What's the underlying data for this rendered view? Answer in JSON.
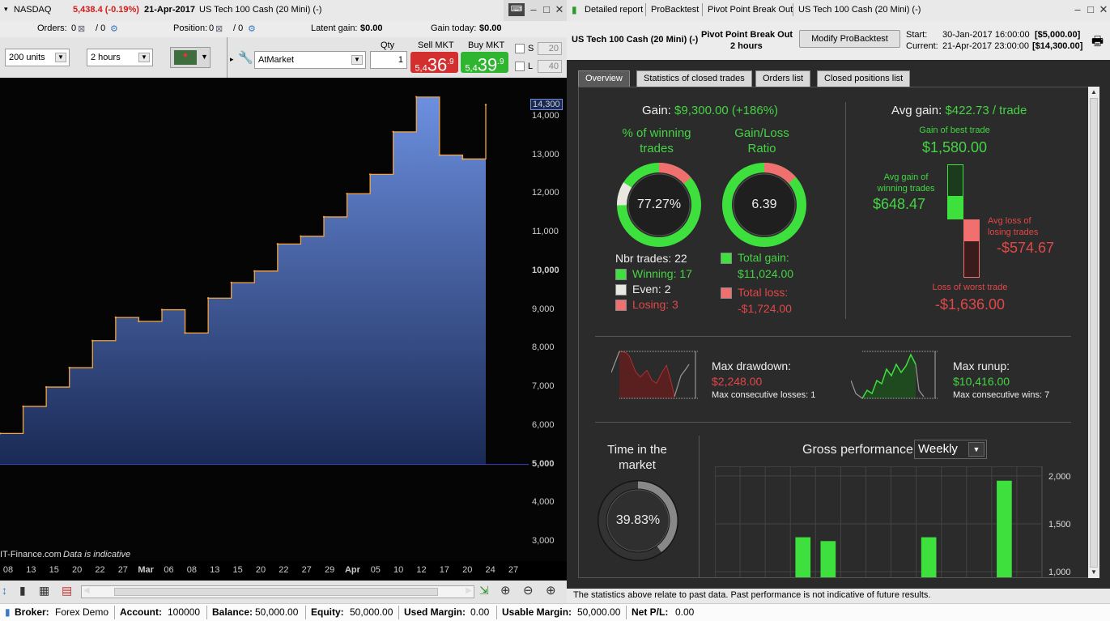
{
  "left": {
    "title": {
      "instrument": "NASDAQ",
      "quote": "5,438.4 (-0.19%)",
      "date": "21-Apr-2017",
      "name": "US Tech 100 Cash (20 Mini) (-)"
    },
    "orders": {
      "orders_label": "Orders:",
      "orders_val": "0",
      "orders_val2": "/ 0",
      "position_label": "Position:",
      "position_val": "0",
      "position_val2": "/ 0",
      "latent_label": "Latent gain:",
      "latent_val": "$0.00",
      "today_label": "Gain today:",
      "today_val": "$0.00"
    },
    "controls": {
      "units": "200 units",
      "timeframe": "2 hours",
      "order_type": "AtMarket",
      "qty_label": "Qty",
      "qty": "1",
      "sell_label": "Sell MKT",
      "sell_prefix": "5,4",
      "sell_big": "36",
      "sell_sup": ".9",
      "buy_label": "Buy MKT",
      "buy_prefix": "5,4",
      "buy_big": "39",
      "buy_sup": ".9",
      "s_label": "S",
      "s_val": "20",
      "l_label": "L",
      "l_val": "40"
    },
    "y_ticks": [
      "14,000",
      "13,000",
      "12,000",
      "11,000",
      "10,000",
      "9,000",
      "8,000",
      "7,000",
      "6,000",
      "5,000",
      "4,000",
      "3,000"
    ],
    "y_current": "14,300",
    "x_ticks": [
      "08",
      "13",
      "15",
      "20",
      "22",
      "27",
      "Mar",
      "06",
      "08",
      "13",
      "15",
      "20",
      "22",
      "27",
      "29",
      "Apr",
      "05",
      "10",
      "12",
      "17",
      "20",
      "24",
      "27"
    ],
    "watermark": "IT-Finance.com",
    "indicative": "Data is indicative"
  },
  "right": {
    "title": {
      "detailed": "Detailed report",
      "probacktest": "ProBacktest",
      "strategy": "Pivot Point Break Out",
      "instrument": "US Tech 100 Cash (20 Mini) (-)"
    },
    "header": {
      "instrument": "US Tech 100 Cash (20 Mini) (-)",
      "strategy": "Pivot Point Break Out",
      "timeframe": "2 hours",
      "modify": "Modify ProBacktest",
      "start_label": "Start:",
      "start_date": "30-Jan-2017 16:00:00",
      "start_val": "[$5,000.00]",
      "current_label": "Current:",
      "current_date": "21-Apr-2017 23:00:00",
      "current_val": "[$14,300.00]"
    },
    "tabs": [
      "Overview",
      "Statistics of closed trades",
      "Orders list",
      "Closed positions list"
    ],
    "overview": {
      "gain_label": "Gain:",
      "gain_val": "$9,300.00 (+186%)",
      "pct_win_title_1": "% of winning",
      "pct_win_title_2": "trades",
      "pct_win_val": "77.27%",
      "gl_title_1": "Gain/Loss",
      "gl_title_2": "Ratio",
      "gl_val": "6.39",
      "nbr_trades": "Nbr trades: 22",
      "winning": "Winning: 17",
      "even": "Even: 2",
      "losing": "Losing: 3",
      "total_gain_label": "Total gain:",
      "total_gain_val": "$11,024.00",
      "total_loss_label": "Total loss:",
      "total_loss_val": "-$1,724.00",
      "avg_gain_label": "Avg gain:",
      "avg_gain_val": "$422.73 / trade",
      "best_label": "Gain of best trade",
      "best_val": "$1,580.00",
      "avg_win_label_1": "Avg gain of",
      "avg_win_label_2": "winning trades",
      "avg_win_val": "$648.47",
      "avg_loss_label_1": "Avg loss of",
      "avg_loss_label_2": "losing trades",
      "avg_loss_val": "-$574.67",
      "worst_label": "Loss of worst trade",
      "worst_val": "-$1,636.00",
      "dd_label": "Max drawdown:",
      "dd_val": "$2,248.00",
      "dd_sub": "Max consecutive losses: 1",
      "ru_label": "Max runup:",
      "ru_val": "$10,416.00",
      "ru_sub": "Max consecutive wins: 7",
      "time_title_1": "Time in the",
      "time_title_2": "market",
      "time_val": "39.83%",
      "gross_title": "Gross performance",
      "gross_period": "Weekly",
      "gross_ticks": [
        "2,000",
        "1,500",
        "1,000"
      ]
    },
    "footer": "The statistics above relate to past data. Past performance is not indicative of future results."
  },
  "status": {
    "broker_label": "Broker:",
    "broker_val": "Forex Demo",
    "account_label": "Account:",
    "account_val": "100000",
    "balance_label": "Balance:",
    "balance_val": "50,000.00",
    "equity_label": "Equity:",
    "equity_val": "50,000.00",
    "used_label": "Used Margin:",
    "used_val": "0.00",
    "usable_label": "Usable Margin:",
    "usable_val": "50,000.00",
    "netpl_label": "Net P/L:",
    "netpl_val": "0.00"
  },
  "chart_data": {
    "type": "area",
    "title": "",
    "xlabel": "",
    "ylabel": "",
    "ylim": [
      2500,
      15000
    ],
    "baseline": 5000,
    "current": 14300,
    "x": [
      "08",
      "13",
      "15",
      "20",
      "22",
      "27",
      "Mar",
      "06",
      "08",
      "13",
      "15",
      "20",
      "22",
      "27",
      "29",
      "Apr",
      "05",
      "10",
      "12",
      "17",
      "20",
      "24"
    ],
    "series": [
      {
        "values": [
          5800,
          6500,
          7000,
          7500,
          8200,
          8800,
          8700,
          9000,
          8400,
          9300,
          9700,
          10000,
          10700,
          10900,
          11400,
          12000,
          12500,
          13600,
          14500,
          13000,
          12900,
          14300
        ]
      }
    ],
    "grid": false,
    "colors": {
      "fill_top": "#6c8fe0",
      "fill_bottom": "#1a2a55",
      "line": "#f2a540"
    }
  },
  "gross_chart_data": {
    "type": "bar",
    "title": "",
    "ylim": [
      900,
      2100
    ],
    "values": [
      1360,
      1320,
      1360,
      1950
    ],
    "slots": [
      3,
      4,
      8,
      11
    ],
    "slot_count": 13
  }
}
